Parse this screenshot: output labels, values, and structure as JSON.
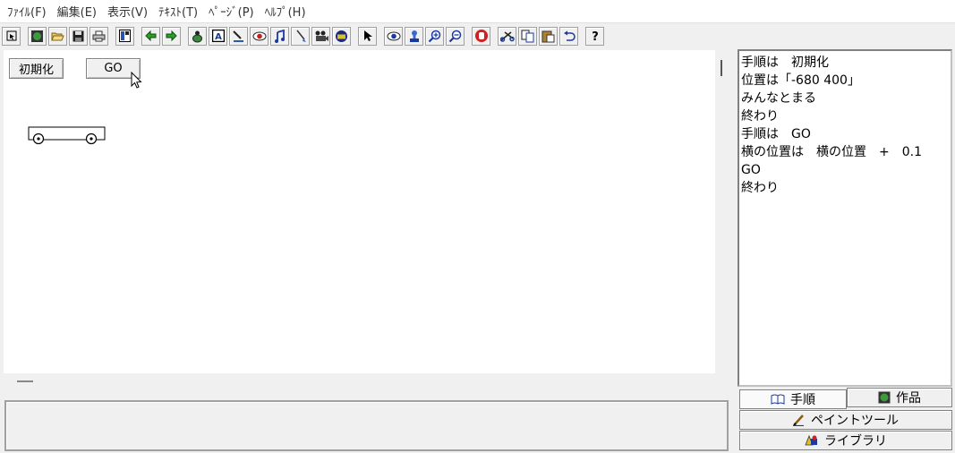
{
  "menu": [
    "ﾌｧｲﾙ(F)",
    "編集(E)",
    "表示(V)",
    "ﾃｷｽﾄ(T)",
    "ﾍﾟｰｼﾞ(P)",
    "ﾍﾙﾌﾟ(H)"
  ],
  "canvas": {
    "buttons": {
      "init_label": "初期化",
      "go_label": "GO"
    }
  },
  "script": {
    "lines": [
      "手順は　初期化",
      "位置は「-680 400」",
      "みんなとまる",
      "終わり",
      "手順は　GO",
      "横の位置は　横の位置　+　0.1",
      "GO",
      "終わり"
    ]
  },
  "tabs": {
    "procedure": "手順",
    "works": "作品",
    "paint_tool": "ペイントツール",
    "library": "ライブラリ"
  },
  "toolbar_icons": [
    "select-arrow-icon",
    "globe-icon",
    "open-folder-icon",
    "save-icon",
    "print-icon",
    "layout-icon",
    "back-arrow-icon",
    "forward-arrow-icon",
    "turtle-icon",
    "text-icon",
    "paint-icon",
    "record-icon",
    "music-icon",
    "brush-icon",
    "movie-icon",
    "camera-icon",
    "pointer-icon",
    "eye-icon",
    "stamp-icon",
    "zoom-in-icon",
    "zoom-out-icon",
    "stop-hand-icon",
    "cut-icon",
    "copy-icon",
    "paste-icon",
    "undo-icon",
    "help-icon"
  ],
  "colors": {
    "window_bg": "#f0f0f0",
    "canvas_bg": "#ffffff",
    "border": "#808080"
  }
}
